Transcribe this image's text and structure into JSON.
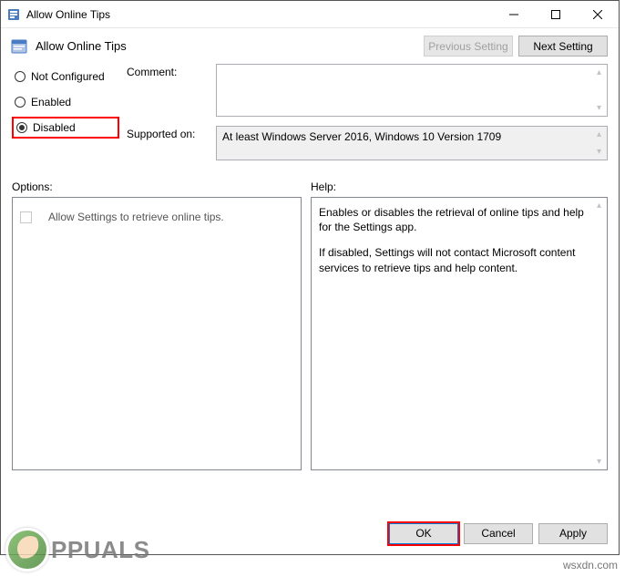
{
  "window": {
    "title": "Allow Online Tips"
  },
  "header": {
    "title": "Allow Online Tips",
    "prev_label": "Previous Setting",
    "next_label": "Next Setting"
  },
  "radios": {
    "not_configured": "Not Configured",
    "enabled": "Enabled",
    "disabled": "Disabled"
  },
  "fields": {
    "comment_label": "Comment:",
    "supported_label": "Supported on:",
    "supported_value": "At least Windows Server 2016, Windows 10 Version 1709"
  },
  "panels": {
    "options_label": "Options:",
    "help_label": "Help:",
    "option_text": "Allow Settings to retrieve online tips.",
    "help_p1": "Enables or disables the retrieval of online tips and help for the Settings app.",
    "help_p2": "If disabled, Settings will not contact Microsoft content services to retrieve tips and help content."
  },
  "footer": {
    "ok": "OK",
    "cancel": "Cancel",
    "apply": "Apply"
  },
  "watermark": {
    "text": "PPUALS",
    "source": "wsxdn.com"
  }
}
